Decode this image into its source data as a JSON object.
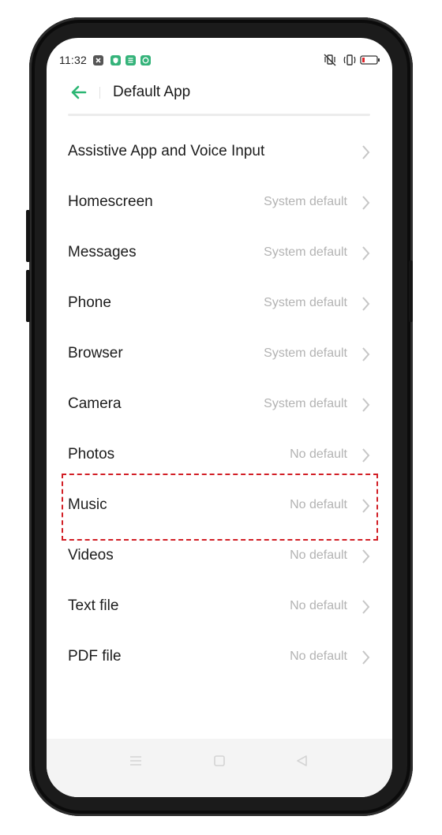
{
  "status_bar": {
    "time": "11:32",
    "icons": [
      "close-box-icon",
      "shield-icon",
      "app-icon",
      "whatsapp-icon",
      "vibrate-off-icon",
      "vibrate-icon",
      "battery-low-icon"
    ]
  },
  "header": {
    "title": "Default App",
    "accent_color": "#2bb673"
  },
  "list": {
    "items": [
      {
        "label": "Assistive App and Voice Input",
        "value": ""
      },
      {
        "label": "Homescreen",
        "value": "System default"
      },
      {
        "label": "Messages",
        "value": "System default"
      },
      {
        "label": "Phone",
        "value": "System default"
      },
      {
        "label": "Browser",
        "value": "System default"
      },
      {
        "label": "Camera",
        "value": "System default"
      },
      {
        "label": "Photos",
        "value": "No default"
      },
      {
        "label": "Music",
        "value": "No default"
      },
      {
        "label": "Videos",
        "value": "No default"
      },
      {
        "label": "Text file",
        "value": "No default"
      },
      {
        "label": "PDF file",
        "value": "No default"
      }
    ]
  },
  "highlight": {
    "item": "Music",
    "color": "#d21f26"
  },
  "nav_bar": {
    "icons": [
      "menu-icon",
      "home-icon",
      "back-triangle-icon"
    ]
  }
}
